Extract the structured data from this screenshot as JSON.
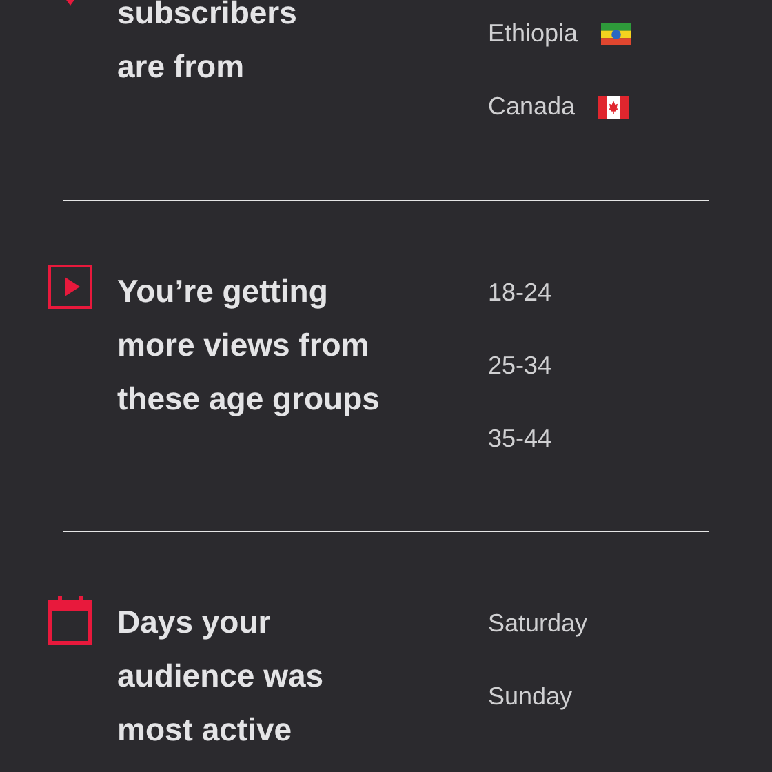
{
  "sections": [
    {
      "kind": "countries",
      "title_lines": [
        "subscribers",
        "are from"
      ],
      "items": [
        {
          "label": "Ethiopia"
        },
        {
          "label": "Canada"
        }
      ]
    },
    {
      "kind": "ages",
      "title_lines": [
        "You’re getting",
        "more views from",
        "these age groups"
      ],
      "items": [
        {
          "label": "18-24"
        },
        {
          "label": "25-34"
        },
        {
          "label": "35-44"
        }
      ]
    },
    {
      "kind": "days",
      "title_lines": [
        "Days your",
        "audience was",
        "most active"
      ],
      "items": [
        {
          "label": "Saturday"
        },
        {
          "label": "Sunday"
        }
      ]
    }
  ]
}
